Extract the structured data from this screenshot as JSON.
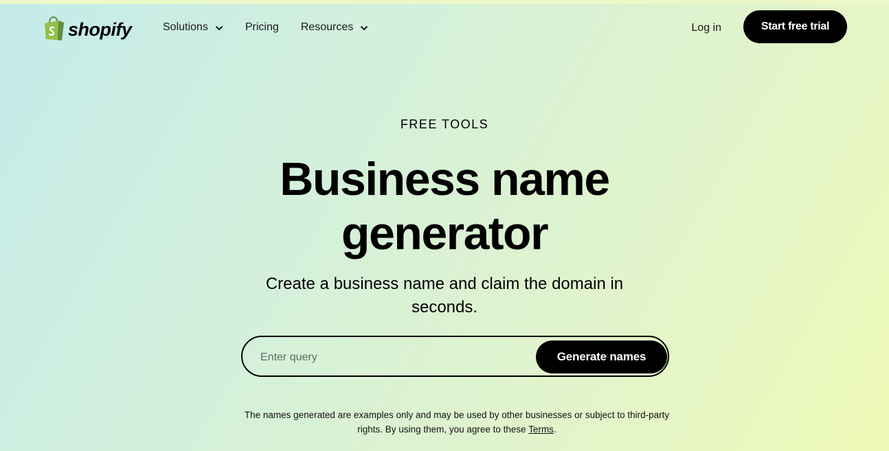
{
  "header": {
    "logo_text": "shopify",
    "logo_icon": "shopify-bag-icon",
    "nav": [
      {
        "label": "Solutions",
        "has_dropdown": true
      },
      {
        "label": "Pricing",
        "has_dropdown": false
      },
      {
        "label": "Resources",
        "has_dropdown": true
      }
    ],
    "login_label": "Log in",
    "cta_label": "Start free trial"
  },
  "hero": {
    "eyebrow": "FREE TOOLS",
    "title_line1": "Business name",
    "title_line2": "generator",
    "subtitle": "Create a business name and claim the domain in seconds."
  },
  "search": {
    "placeholder": "Enter query",
    "value": "",
    "button_label": "Generate names"
  },
  "disclaimer": {
    "text": "The names generated are examples only and may be used by other businesses or subject to third-party rights. By using them, you agree to these ",
    "link_label": "Terms",
    "suffix": "."
  },
  "colors": {
    "brand_green": "#95bf47",
    "brand_green_dark": "#5e8e3e",
    "button_bg": "#000000",
    "button_text": "#ffffff"
  }
}
